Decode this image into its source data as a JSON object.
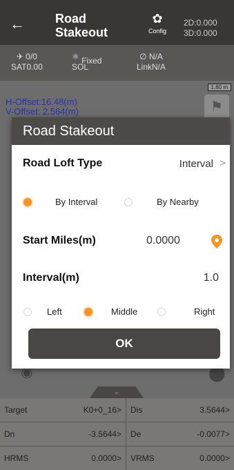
{
  "header": {
    "back": "←",
    "title_line1": "Road",
    "title_line2": "Stakeout",
    "config_label": "Config",
    "dim2d": "2D:0.000",
    "dim3d": "3D:0.000"
  },
  "status": {
    "sat_top": "0/0",
    "sat_bottom": "SAT0.00",
    "sol_top": "Fixed",
    "sol_bottom": "SOL",
    "link_top": "N/A",
    "link_bottom": "LinkN/A"
  },
  "map": {
    "h_offset": "H-Offset:16.48(m)",
    "v_offset": "V-Offset: 2.564(m)",
    "scale": "1.80 m",
    "tab_chevron": "⌄"
  },
  "grid": [
    {
      "key": "Target",
      "value": "K0+0_16>"
    },
    {
      "key": "Dis",
      "value": "3.5644>"
    },
    {
      "key": "Dn",
      "value": "-3.5644>"
    },
    {
      "key": "De",
      "value": "-0.0077>"
    },
    {
      "key": "HRMS",
      "value": "0.0000>"
    },
    {
      "key": "VRMS",
      "value": "0.0000>"
    }
  ],
  "dialog": {
    "title": "Road Stakeout",
    "loft_label": "Road Loft Type",
    "loft_value": "Interval",
    "loft_chevron": ">",
    "by_interval": "By Interval",
    "by_nearby": "By Nearby",
    "start_label": "Start Miles(m)",
    "start_value": "0.0000",
    "interval_label": "Interval(m)",
    "interval_value": "1.0",
    "left": "Left",
    "middle": "Middle",
    "right": "Right",
    "ok": "OK"
  },
  "colors": {
    "accent": "#f7931e",
    "header": "#3a3633",
    "dialog_title": "#4e4a47"
  }
}
